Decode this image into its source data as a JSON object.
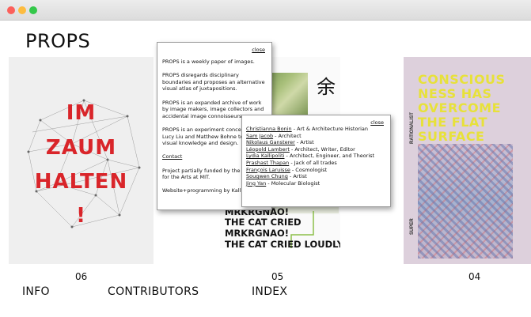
{
  "site": {
    "logo": "PROPS"
  },
  "issues": [
    {
      "number": "06",
      "cover_text": [
        "IM",
        "ZAUM",
        "HALTEN",
        "!"
      ],
      "accent": "#d9252a"
    },
    {
      "number": "05",
      "cover_text": [
        "MRKRGNAO!",
        "THE CAT CRIED",
        "MRKRGNAO!",
        "THE CAT CRIED LOUDLY"
      ],
      "glyph": "余"
    },
    {
      "number": "04",
      "cover_text": [
        "CONSCIOUS",
        "NESS HAS",
        "OVERCOME",
        "THE FLAT",
        "SURFACE"
      ],
      "side_labels": [
        "RATIONALIST",
        "SUPER"
      ],
      "accent": "#e7e13a"
    }
  ],
  "nav": {
    "info": "INFO",
    "contributors": "CONTRIBUTORS",
    "index": "INDEX"
  },
  "about_popup": {
    "close": "close",
    "p1": "PROPS is a weekly paper of images.",
    "p2": "PROPS disregards disciplinary boundaries and proposes an alternative visual atlas of juxtapositions.",
    "p3": "PROPS is an expanded archive of work by image makers, image collectors and accidental image connoisseurs.",
    "p4": "PROPS is an experiment conceived by Lucy Liu and Matthew Bohne to explore visual knowledge and design.",
    "contact": "Contact",
    "funding": "Project partially funded by the Council for the Arts at MIT.",
    "website": "Website+programming by Kalli."
  },
  "contributors_popup": {
    "close": "close",
    "items": [
      {
        "name": "Christianna Bonin",
        "role": " - Art & Architecture Historian"
      },
      {
        "name": "Sam Jacob",
        "role": " - Architect"
      },
      {
        "name": "Nikolaus Gansterer",
        "role": " - Artist"
      },
      {
        "name": "Léopold Lambert",
        "role": " - Architect, Writer, Editor"
      },
      {
        "name": "Lydia Kallipoliti",
        "role": " - Architect, Engineer, and Theorist"
      },
      {
        "name": "Prashast Thapan",
        "role": " - Jack of all trades"
      },
      {
        "name": "François Laruisse",
        "role": " - Cosmologist"
      },
      {
        "name": "Sougwen Chung",
        "role": " - Artist"
      },
      {
        "name": "Jing Yan",
        "role": " - Molecular Biologist"
      }
    ]
  }
}
